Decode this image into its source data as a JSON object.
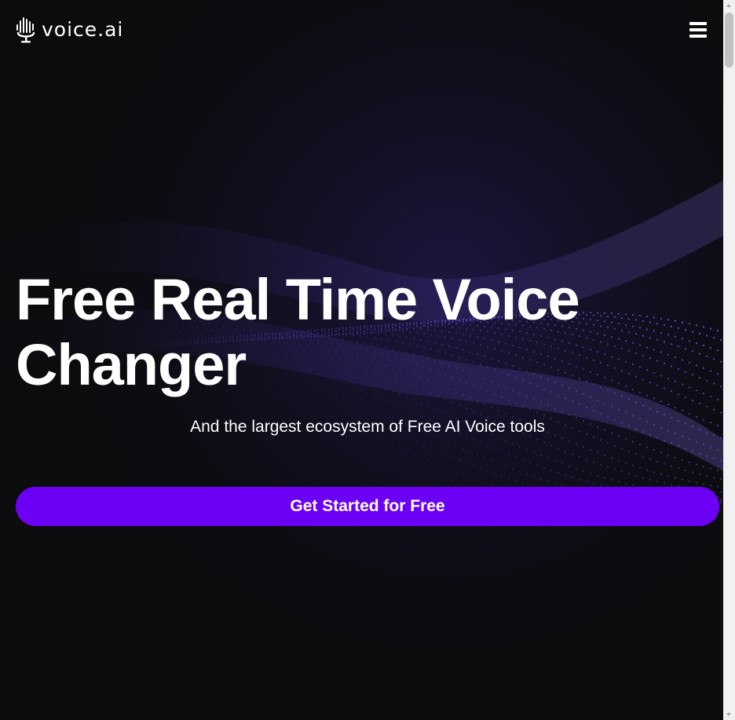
{
  "header": {
    "logo_text": "voice.ai",
    "menu_icon": "hamburger-menu-icon"
  },
  "hero": {
    "title_line1": "Free Real Time Voice",
    "title_line2": "Changer",
    "subtitle": "And the largest ecosystem of Free AI Voice tools",
    "cta_label": "Get Started for Free"
  },
  "colors": {
    "background": "#0c0b0e",
    "accent": "#6b00f5",
    "wave": "#7b5cff",
    "text": "#ffffff"
  }
}
